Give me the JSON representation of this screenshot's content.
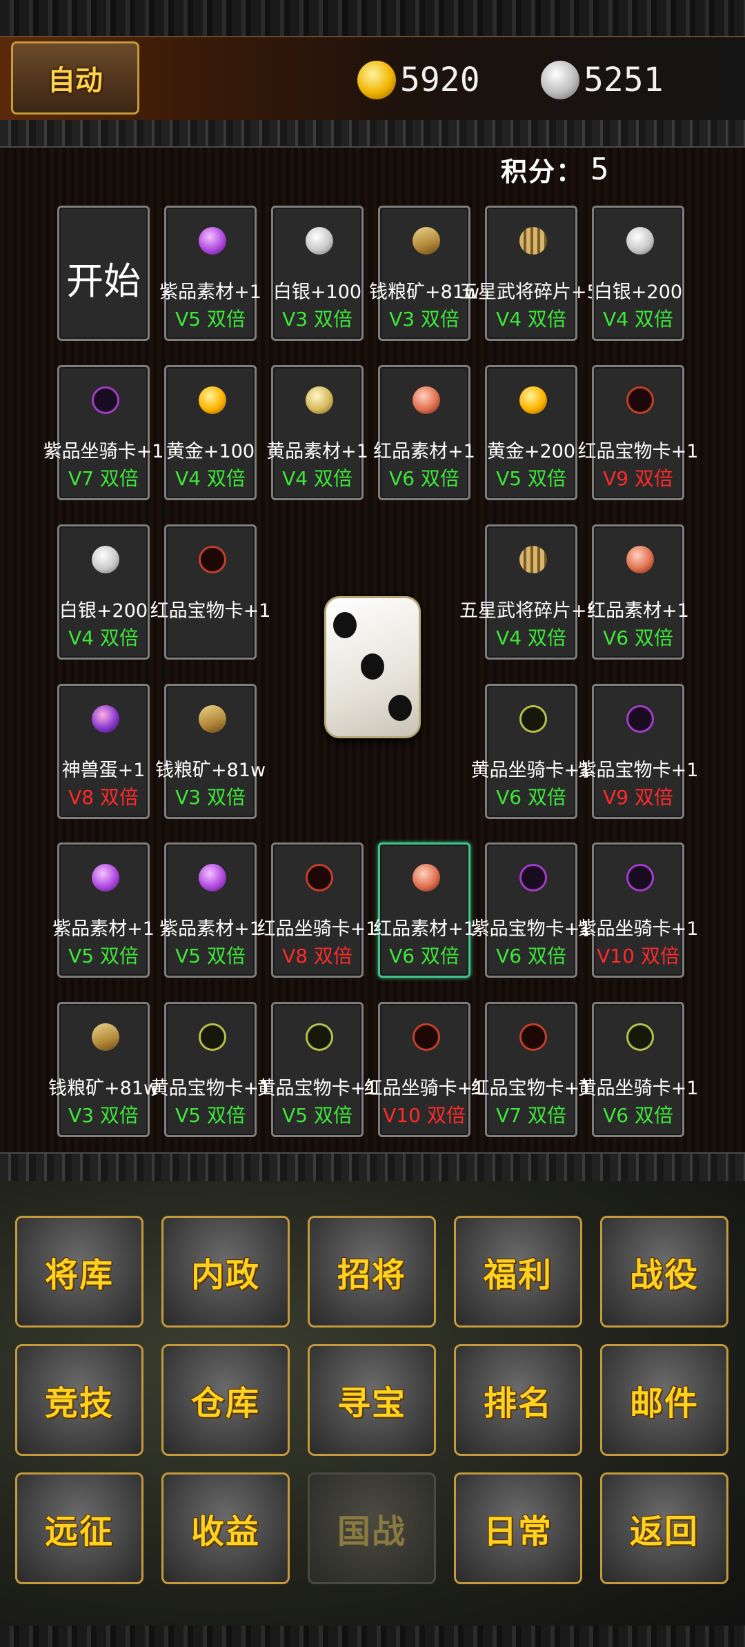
{
  "header": {
    "auto_label": "自动",
    "gold_icon": "gold-ingot-icon",
    "gold_amount": "5920",
    "silver_icon": "silver-ingot-icon",
    "silver_amount": "5251"
  },
  "score": {
    "label": "积分：",
    "value": "5"
  },
  "board": {
    "start_label": "开始",
    "dice_face": 3,
    "cells": [
      {
        "name": "紫品素材+1",
        "mult": "V5 双倍",
        "icon": "purple-gem-icon"
      },
      {
        "name": "白银+100",
        "mult": "V3 双倍",
        "icon": "silver-ingot-icon"
      },
      {
        "name": "钱粮矿+81w",
        "mult": "V3 双倍",
        "icon": "grain-icon"
      },
      {
        "name": "五星武将碎片+50",
        "mult": "V4 双倍",
        "icon": "general-shard-icon"
      },
      {
        "name": "白银+200",
        "mult": "V4 双倍",
        "icon": "silver-ingot-icon"
      },
      {
        "name": "紫品坐骑卡+1",
        "mult": "V7 双倍",
        "icon": "purple-mount-card-icon"
      },
      {
        "name": "黄金+100",
        "mult": "V4 双倍",
        "icon": "gold-ingot-icon"
      },
      {
        "name": "黄品素材+1",
        "mult": "V4 双倍",
        "icon": "yellow-gem-icon"
      },
      {
        "name": "红品素材+1",
        "mult": "V6 双倍",
        "icon": "red-gem-icon"
      },
      {
        "name": "黄金+200",
        "mult": "V5 双倍",
        "icon": "gold-ingot-icon"
      },
      {
        "name": "红品宝物卡+1",
        "mult": "V9 双倍",
        "icon": "red-treasure-card-icon"
      },
      {
        "name": "白银+200",
        "mult": "V4 双倍",
        "icon": "silver-ingot-icon"
      },
      {
        "name": "红品宝物卡+1",
        "mult": "",
        "icon": "red-treasure-card-icon"
      },
      {
        "name": "五星武将碎片+50",
        "mult": "V4 双倍",
        "icon": "general-shard-icon"
      },
      {
        "name": "红品素材+1",
        "mult": "V6 双倍",
        "icon": "red-gem-icon"
      },
      {
        "name": "神兽蛋+1",
        "mult": "V8 双倍",
        "icon": "beast-egg-icon"
      },
      {
        "name": "钱粮矿+81w",
        "mult": "V3 双倍",
        "icon": "grain-icon"
      },
      {
        "name": "黄品坐骑卡+1",
        "mult": "V6 双倍",
        "icon": "yellow-mount-card-icon"
      },
      {
        "name": "紫品宝物卡+1",
        "mult": "V9 双倍",
        "icon": "purple-treasure-card-icon"
      },
      {
        "name": "紫品素材+1",
        "mult": "V5 双倍",
        "icon": "purple-gem-icon"
      },
      {
        "name": "紫品素材+1",
        "mult": "V5 双倍",
        "icon": "purple-gem-icon"
      },
      {
        "name": "红品坐骑卡+1",
        "mult": "V8 双倍",
        "icon": "red-mount-card-icon"
      },
      {
        "name": "红品素材+1",
        "mult": "V6 双倍",
        "icon": "red-gem-icon",
        "selected": true
      },
      {
        "name": "紫品宝物卡+1",
        "mult": "V6 双倍",
        "icon": "purple-treasure-card-icon"
      },
      {
        "name": "紫品坐骑卡+1",
        "mult": "V10 双倍",
        "icon": "purple-mount-card-icon"
      },
      {
        "name": "钱粮矿+81w",
        "mult": "V3 双倍",
        "icon": "grain-icon"
      },
      {
        "name": "黄品宝物卡+1",
        "mult": "V5 双倍",
        "icon": "yellow-treasure-card-icon"
      },
      {
        "name": "黄品宝物卡+1",
        "mult": "V5 双倍",
        "icon": "yellow-treasure-card-icon"
      },
      {
        "name": "红品坐骑卡+1",
        "mult": "V10 双倍",
        "icon": "red-mount-card-icon"
      },
      {
        "name": "红品宝物卡+1",
        "mult": "V7 双倍",
        "icon": "red-treasure-card-icon"
      },
      {
        "name": "黄品坐骑卡+1",
        "mult": "V6 双倍",
        "icon": "yellow-mount-card-icon"
      }
    ]
  },
  "menu": [
    {
      "label": "将库",
      "enabled": true
    },
    {
      "label": "内政",
      "enabled": true
    },
    {
      "label": "招将",
      "enabled": true
    },
    {
      "label": "福利",
      "enabled": true
    },
    {
      "label": "战役",
      "enabled": true
    },
    {
      "label": "竞技",
      "enabled": true
    },
    {
      "label": "仓库",
      "enabled": true
    },
    {
      "label": "寻宝",
      "enabled": true
    },
    {
      "label": "排名",
      "enabled": true
    },
    {
      "label": "邮件",
      "enabled": true
    },
    {
      "label": "远征",
      "enabled": true
    },
    {
      "label": "收益",
      "enabled": true
    },
    {
      "label": "国战",
      "enabled": false
    },
    {
      "label": "日常",
      "enabled": true
    },
    {
      "label": "返回",
      "enabled": true
    }
  ],
  "colors": {
    "mult_green": "#3ee83a",
    "mult_red": "#ff2a2a",
    "selected_border": "#3fc48a",
    "menu_text": "#ffd21f"
  }
}
